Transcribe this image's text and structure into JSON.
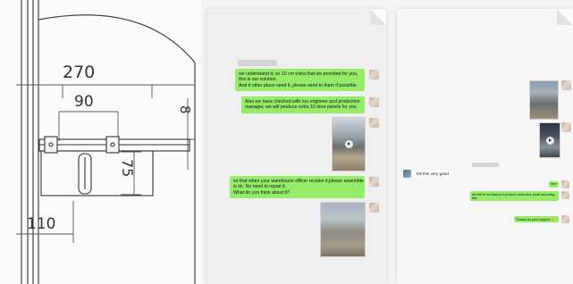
{
  "drawing": {
    "dimensions": [
      "270",
      "90",
      "8",
      "75",
      "110"
    ]
  },
  "chat_left": {
    "timestamp": "",
    "messages": [
      {
        "lines": [
          "we understand it, so 10 cm extra that we provided for you,",
          "this is our solution.",
          "And if other place need it, please send to them if possible."
        ]
      },
      {
        "lines": [
          "Also we have checked with our engineer and production",
          "manager, we will produce extra 10 door panels for you."
        ]
      },
      {
        "lines": [
          "so that when your warehouse officer receive it,please assemble",
          "is ok. No need to repair it.",
          "What do you think about it?"
        ]
      }
    ]
  },
  "chat_right": {
    "incoming_text": "Ok this very good",
    "timestamp": "",
    "outgoing": [
      "nice",
      "we will let our factory to produce extra door panel according this",
      "Thanks for your support"
    ],
    "emoji": "😊"
  },
  "colors": {
    "bubble_green": "#95ec69",
    "page_background": "#efefef"
  }
}
